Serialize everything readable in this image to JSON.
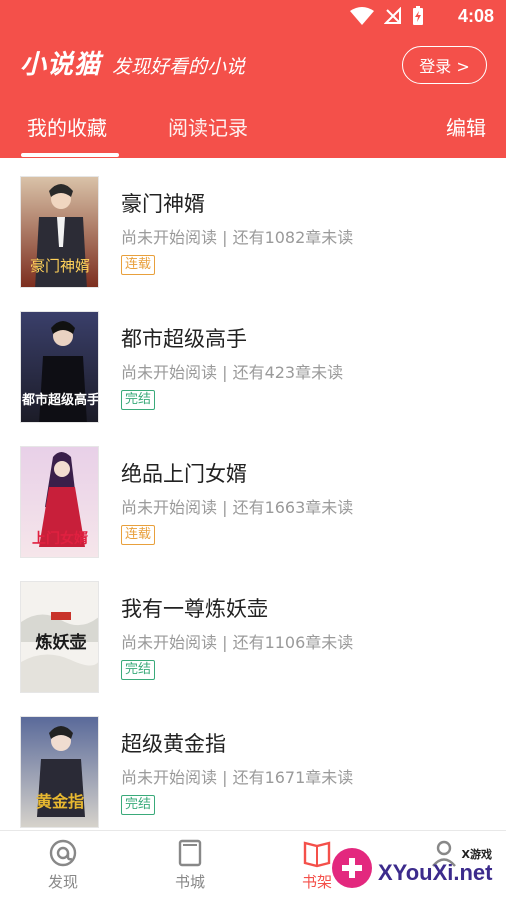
{
  "status_bar": {
    "time": "4:08"
  },
  "header": {
    "app_title": "小说猫",
    "slogan": "发现好看的小说",
    "login_label": "登录 >"
  },
  "tabs": {
    "favorites": "我的收藏",
    "history": "阅读记录",
    "edit": "编辑"
  },
  "books": [
    {
      "title": "豪门神婿",
      "info": "尚未开始阅读 | 还有1082章未读",
      "tag": "连载"
    },
    {
      "title": "都市超级高手",
      "info": "尚未开始阅读 | 还有423章未读",
      "tag": "完结"
    },
    {
      "title": "绝品上门女婿",
      "info": "尚未开始阅读 | 还有1663章未读",
      "tag": "连载"
    },
    {
      "title": "我有一尊炼妖壶",
      "info": "尚未开始阅读 | 还有1106章未读",
      "tag": "完结"
    },
    {
      "title": "超级黄金指",
      "info": "尚未开始阅读 | 还有1671章未读",
      "tag": "完结"
    }
  ],
  "covers": [
    {
      "text": "豪门神婿"
    },
    {
      "text": "都市超级高手"
    },
    {
      "text": "上门女婿"
    },
    {
      "text": "炼妖壶"
    },
    {
      "text": "黄金指"
    }
  ],
  "bottom_nav": {
    "discover": "发现",
    "store": "书城",
    "shelf": "书架"
  },
  "watermark": {
    "text": "XYouXi.net",
    "small": "X游戏"
  },
  "colors": {
    "primary": "#f4504a",
    "serial_tag": "#e8a03c",
    "done_tag": "#3aaa7a"
  }
}
